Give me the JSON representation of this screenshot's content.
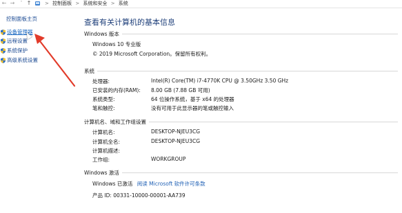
{
  "address_bar": {
    "back_icon": "arrow-left-icon",
    "forward_icon": "arrow-right-icon",
    "dropdown_icon": "chevron-down-icon",
    "up_icon": "arrow-up-icon",
    "folder_icon": "control-panel-icon",
    "separator": ">",
    "crumbs": [
      "控制面板",
      "系统和安全",
      "系统"
    ]
  },
  "sidebar": {
    "home": "控制面板主页",
    "items": [
      {
        "label": "设备管理器",
        "icon": "shield-icon",
        "active": true
      },
      {
        "label": "远程设置",
        "icon": "shield-icon"
      },
      {
        "label": "系统保护",
        "icon": "shield-icon"
      },
      {
        "label": "高级系统设置",
        "icon": "shield-icon"
      }
    ]
  },
  "main": {
    "title": "查看有关计算机的基本信息",
    "edition": {
      "heading": "Windows 版本",
      "name": "Windows 10 专业版",
      "copyright": "© 2019 Microsoft Corporation。保留所有权利。"
    },
    "system": {
      "heading": "系统",
      "rows": [
        {
          "key": "处理器:",
          "value": "Intel(R) Core(TM) i7-4770K CPU @ 3.50GHz   3.50 GHz"
        },
        {
          "key": "已安装的内存(RAM):",
          "value": "8.00 GB (7.88 GB 可用)"
        },
        {
          "key": "系统类型:",
          "value": "64 位操作系统，基于 x64 的处理器"
        },
        {
          "key": "笔和触控:",
          "value": "没有可用于此显示器的笔或触控输入"
        }
      ]
    },
    "computer": {
      "heading": "计算机名、域和工作组设置",
      "rows": [
        {
          "key": "计算机名:",
          "value": "DESKTOP-NJEU3CG"
        },
        {
          "key": "计算机全名:",
          "value": "DESKTOP-NJEU3CG"
        },
        {
          "key": "计算机描述:",
          "value": ""
        },
        {
          "key": "工作组:",
          "value": "WORKGROUP"
        }
      ]
    },
    "activation": {
      "heading": "Windows 激活",
      "status": "Windows 已激活",
      "license_link": "阅读 Microsoft 软件许可条款",
      "product_id": "产品 ID: 00331-10000-00001-AA739"
    }
  },
  "colors": {
    "annotation_arrow": "#e23b2a",
    "link": "#1e5fb4",
    "title": "#1e3f7a"
  }
}
